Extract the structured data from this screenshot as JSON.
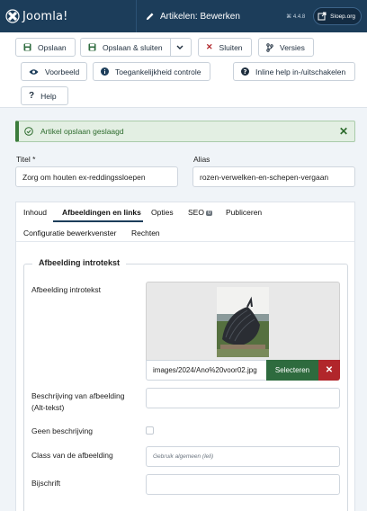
{
  "header": {
    "logo_text": "Joomla!",
    "page_title": "Artikelen: Bewerken",
    "version": "⌘ 4.4.8",
    "site_button": "Sloep.org"
  },
  "toolbar": {
    "save": "Opslaan",
    "save_close": "Opslaan & sluiten",
    "close": "Sluiten",
    "versions": "Versies",
    "preview": "Voorbeeld",
    "accessibility": "Toegankelijkheid controle",
    "inline_help": "Inline help in-/uitschakelen",
    "help": "Help"
  },
  "alert": {
    "message": "Artikel opslaan geslaagd"
  },
  "fields": {
    "title_label": "Titel *",
    "title_value": "Zorg om houten ex-reddingssloepen",
    "alias_label": "Alias",
    "alias_value": "rozen-verwelken-en-schepen-vergaan"
  },
  "tabs": [
    {
      "label": "Inhoud"
    },
    {
      "label": "Afbeeldingen en links"
    },
    {
      "label": "Opties"
    },
    {
      "label": "SEO"
    },
    {
      "label": "Publiceren"
    },
    {
      "label": "Configuratie bewerkvenster"
    },
    {
      "label": "Rechten"
    }
  ],
  "seo_badge": "0",
  "images": {
    "legend": "Afbeelding introtekst",
    "intro_label": "Afbeelding introtekst",
    "path": "images/2024/Ano%20voor02.jpg",
    "select_button": "Selecteren",
    "clear_button": "✕",
    "alt_label": "Beschrijving van afbeelding (Alt-tekst)",
    "no_desc_label": "Geen beschrijving",
    "class_label": "Class van de afbeelding",
    "class_placeholder": "Gebruik algemeen (leli)",
    "caption_label": "Bijschrift"
  },
  "colors": {
    "header_bg": "#1c3d5a",
    "success_bg": "#e3efe3",
    "success_text": "#2d6b2d",
    "select_green": "#2e6b3e",
    "clear_red": "#b1262b"
  }
}
